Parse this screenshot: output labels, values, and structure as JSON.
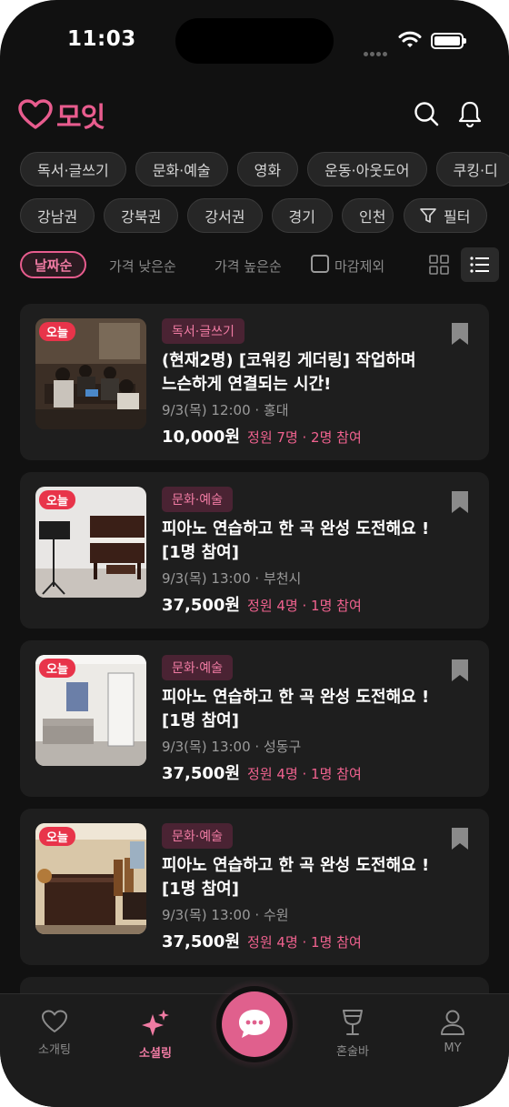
{
  "status_bar": {
    "time": "11:03"
  },
  "header": {
    "logo_text": "모잇"
  },
  "category_chips": [
    "독서·글쓰기",
    "문화·예술",
    "영화",
    "운동·아웃도어",
    "쿠킹·디"
  ],
  "region_chips": [
    "강남권",
    "강북권",
    "강서권",
    "경기",
    "인천"
  ],
  "filter_label": "필터",
  "sort": {
    "active": "날짜순",
    "options": [
      "가격 낮은순",
      "가격 높은순"
    ],
    "exclude_closed": "마감제외"
  },
  "cards": [
    {
      "badge": "오늘",
      "category": "독서·글쓰기",
      "title": "(현재2명) [코워킹 게더링] 작업하며 느슨하게 연결되는 시간!",
      "meta": "9/3(목) 12:00 · 홍대",
      "price": "10,000원",
      "capacity": "정원 7명 · 2명 참여"
    },
    {
      "badge": "오늘",
      "category": "문화·예술",
      "title": "피아노 연습하고 한 곡 완성 도전해요 ! [1명 참여]",
      "meta": "9/3(목) 13:00 · 부천시",
      "price": "37,500원",
      "capacity": "정원 4명 · 1명 참여"
    },
    {
      "badge": "오늘",
      "category": "문화·예술",
      "title": "피아노 연습하고 한 곡 완성 도전해요 ! [1명 참여]",
      "meta": "9/3(목) 13:00 · 성동구",
      "price": "37,500원",
      "capacity": "정원 4명 · 1명 참여"
    },
    {
      "badge": "오늘",
      "category": "문화·예술",
      "title": "피아노 연습하고 한 곡 완성 도전해요 ! [1명 참여]",
      "meta": "9/3(목) 13:00 · 수원",
      "price": "37,500원",
      "capacity": "정원 4명 · 1명 참여"
    }
  ],
  "bottom_nav": {
    "items": [
      {
        "label": "소개팅",
        "icon": "heart-icon"
      },
      {
        "label": "소셜링",
        "icon": "sparkle-icon"
      },
      {
        "label": "혼술바",
        "icon": "cocktail-icon"
      },
      {
        "label": "MY",
        "icon": "person-icon"
      }
    ],
    "active": "소셜링"
  },
  "colors": {
    "accent": "#e85c8e",
    "background": "#111111",
    "card": "#1e1e1e",
    "badge": "#e8344a"
  }
}
